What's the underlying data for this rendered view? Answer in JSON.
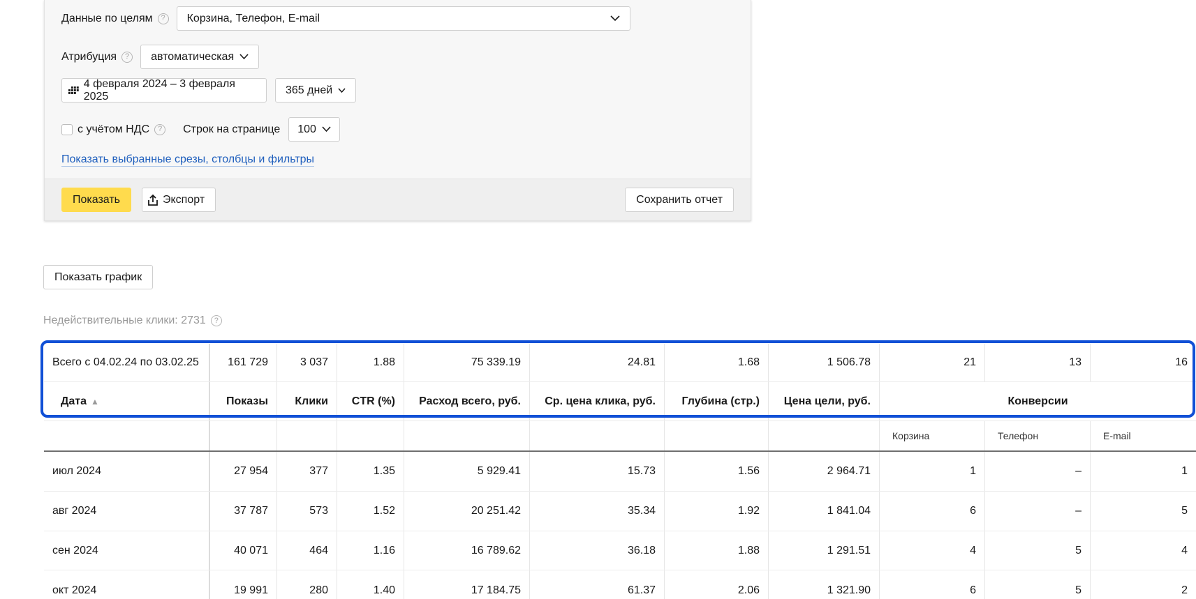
{
  "filters": {
    "goals_label": "Данные по целям",
    "goals_value": "Корзина, Телефон, E-mail",
    "attribution_label": "Атрибуция",
    "attribution_value": "автоматическая",
    "date_range": "4 февраля 2024 – 3 февраля 2025",
    "period": "365 дней",
    "vat_label": "с учётом НДС",
    "rows_label": "Строк на странице",
    "rows_value": "100",
    "show_link": "Показать выбранные срезы, столбцы и фильтры",
    "help_glyph": "?"
  },
  "footer": {
    "show_button": "Показать",
    "export_button": "Экспорт",
    "save_button": "Сохранить отчет"
  },
  "graph_button": "Показать график",
  "invalid_clicks": "Недействительные клики: 2731",
  "colors": {
    "accent": "#ffdb4d",
    "highlight": "#1150d6",
    "link": "#1f5fbd"
  },
  "table": {
    "total": [
      "Всего с 04.02.24 по 03.02.25",
      "161 729",
      "3 037",
      "1.88",
      "75 339.19",
      "24.81",
      "1.68",
      "1 506.78",
      "21",
      "13",
      "16"
    ],
    "headers": [
      "Дата",
      "Показы",
      "Клики",
      "CTR (%)",
      "Расход всего, руб.",
      "Ср. цена клика, руб.",
      "Глубина (стр.)",
      "Цена цели, руб.",
      "Конверсии"
    ],
    "sort_glyph": "▲",
    "subheaders": [
      "Корзина",
      "Телефон",
      "E-mail"
    ],
    "rows": [
      [
        "июл 2024",
        "27 954",
        "377",
        "1.35",
        "5 929.41",
        "15.73",
        "1.56",
        "2 964.71",
        "1",
        "–",
        "1"
      ],
      [
        "авг 2024",
        "37 787",
        "573",
        "1.52",
        "20 251.42",
        "35.34",
        "1.92",
        "1 841.04",
        "6",
        "–",
        "5"
      ],
      [
        "сен 2024",
        "40 071",
        "464",
        "1.16",
        "16 789.62",
        "36.18",
        "1.88",
        "1 291.51",
        "4",
        "5",
        "4"
      ],
      [
        "окт 2024",
        "19 991",
        "280",
        "1.40",
        "17 184.75",
        "61.37",
        "2.06",
        "1 321.90",
        "6",
        "5",
        "2"
      ]
    ]
  }
}
